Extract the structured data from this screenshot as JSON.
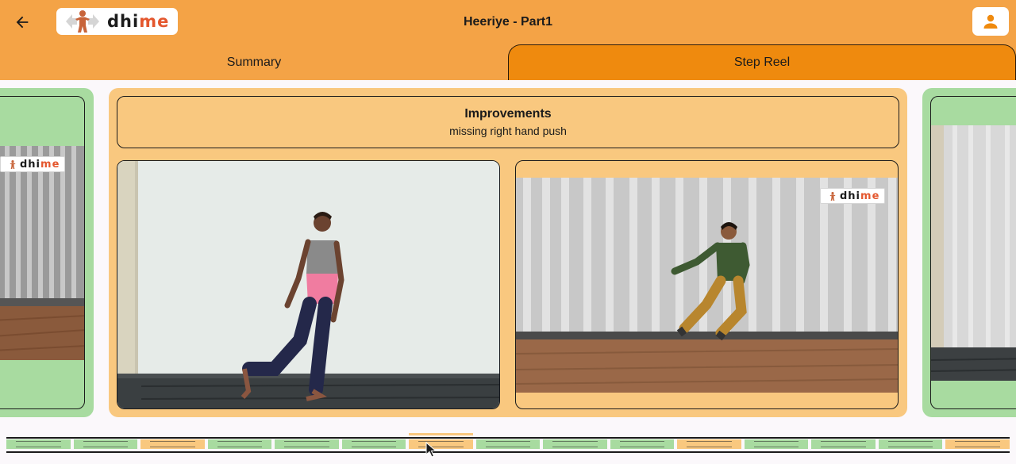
{
  "header": {
    "back_icon": "arrow-left-icon",
    "logo": {
      "text_prefix": "dhi",
      "text_suffix": "me"
    },
    "title": "Heeriye - Part1",
    "profile_icon": "user-icon"
  },
  "tabs": [
    {
      "label": "Summary",
      "active": false
    },
    {
      "label": "Step Reel",
      "active": true
    }
  ],
  "main_card": {
    "improvements_title": "Improvements",
    "improvements_text": "missing right hand push"
  },
  "watermark": {
    "text_prefix": "dhi",
    "text_suffix": "me"
  },
  "timeline": {
    "segments": [
      "good",
      "good",
      "improve",
      "good",
      "good",
      "good",
      "improve",
      "good",
      "good",
      "good",
      "improve",
      "good",
      "good",
      "good",
      "improve"
    ],
    "active_index": 6
  },
  "colors": {
    "header": "#f4a346",
    "tab_active": "#ef8a0e",
    "card_improve": "#f9c87f",
    "card_good": "#a8dba0"
  }
}
